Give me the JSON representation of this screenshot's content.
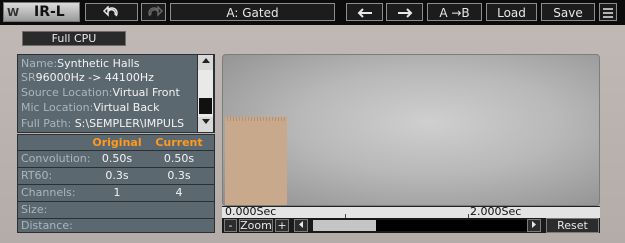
{
  "toolbar": {
    "logo_name": "IR-L",
    "preset_name": "A: Gated",
    "ab_label": "A →B",
    "load_label": "Load",
    "save_label": "Save",
    "undo_icon": "undo-icon",
    "redo_icon": "redo-icon",
    "prev_icon": "arrow-left-icon",
    "next_icon": "arrow-right-icon",
    "menu_icon": "menu-icon"
  },
  "cpu_button_label": "Full CPU",
  "info": {
    "name_label": "Name:",
    "name_value": "Synthetic Halls",
    "sr_label": "SR",
    "sr_value": "96000Hz -> 44100Hz",
    "source_label": "Source Location:",
    "source_value": "Virtual Front",
    "mic_label": "Mic Location:",
    "mic_value": "Virtual Back",
    "path_label": "Full Path:",
    "path_value": "S:\\SEMPLER\\IMPULS"
  },
  "params": {
    "col_original": "Original",
    "col_current": "Current",
    "rows": [
      {
        "label": "Convolution:",
        "original": "0.50s",
        "current": "0.50s"
      },
      {
        "label": "RT60:",
        "original": "0.3s",
        "current": "0.3s"
      },
      {
        "label": "Channels:",
        "original": "1",
        "current": "4"
      },
      {
        "label": "Size:",
        "original": "",
        "current": ""
      },
      {
        "label": "Distance:",
        "original": "",
        "current": ""
      }
    ]
  },
  "display": {
    "time_start": "0.000Sec",
    "time_end": "2.000Sec",
    "zoom_label": "Zoom",
    "zoom_minus": "-",
    "zoom_plus": "+",
    "reset_label": "Reset",
    "scroll_left_icon": "arrow-left-icon",
    "scroll_right_icon": "arrow-right-icon"
  },
  "colors": {
    "accent_orange": "#ff9a1e",
    "panel_bg": "#5c6870",
    "ir_fill": "#c9a98b"
  }
}
